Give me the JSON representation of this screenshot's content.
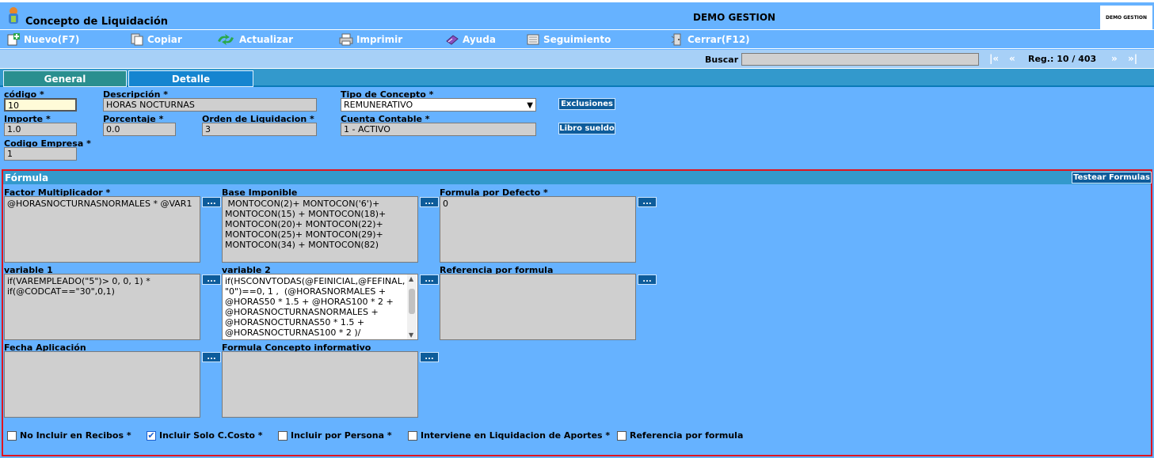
{
  "header": {
    "title": "Concepto de Liquidación",
    "company": "DEMO GESTION",
    "company_logo_text": "DEMO GESTION"
  },
  "toolbar": {
    "items": [
      {
        "label": "Nuevo(F7)",
        "icon": "new-icon"
      },
      {
        "label": "Copiar",
        "icon": "copy-icon"
      },
      {
        "label": "Actualizar",
        "icon": "refresh-icon"
      },
      {
        "label": "Imprimir",
        "icon": "print-icon"
      },
      {
        "label": "Ayuda",
        "icon": "help-icon"
      },
      {
        "label": "Seguimiento",
        "icon": "tracking-icon"
      },
      {
        "label": "Cerrar(F12)",
        "icon": "close-icon"
      }
    ]
  },
  "search": {
    "label": "Buscar",
    "value": "",
    "first": "|«",
    "prev": "«",
    "next": "»",
    "last": "»|",
    "record": "Reg.: 10 / 403"
  },
  "tabs": [
    {
      "label": "General",
      "active": true
    },
    {
      "label": "Detalle",
      "active": false
    }
  ],
  "form": {
    "codigo_label": "código *",
    "codigo_value": "10",
    "descripcion_label": "Descripción *",
    "descripcion_value": "HORAS NOCTURNAS",
    "tipo_label": "Tipo de Concepto *",
    "tipo_value": "REMUNERATIVO",
    "exclusiones_button": "Exclusiones",
    "importe_label": "Importe *",
    "importe_value": "1.0",
    "porcentaje_label": "Porcentaje *",
    "porcentaje_value": "0.0",
    "orden_label": "Orden de Liquidacion *",
    "orden_value": "3",
    "cuenta_label": "Cuenta Contable *",
    "cuenta_value": "1 - ACTIVO",
    "libro_button": "Libro sueldo",
    "empresa_label": "Codigo Empresa *",
    "empresa_value": "1"
  },
  "formula": {
    "title": "Fórmula",
    "test_button": "Testear Formulas",
    "dots": "...",
    "factor_label": "Factor Multiplicador *",
    "factor_value": "@HORASNOCTURNASNORMALES * @VAR1",
    "base_label": "Base Imponible",
    "base_value": " MONTOCON(2)+ MONTOCON('6')+ MONTOCON(15) + MONTOCON(18)+ MONTOCON(20)+ MONTOCON(22)+ MONTOCON(25)+ MONTOCON(29)+ MONTOCON(34) + MONTOCON(82)",
    "defecto_label": "Formula por Defecto *",
    "defecto_value": "0",
    "var1_label": "variable 1",
    "var1_value": "if(VAREMPLEADO(\"5\")> 0, 0, 1) * if(@CODCAT==\"30\",0,1)",
    "var2_label": "variable 2",
    "var2_value": "if(HSCONVTODAS(@FEINICIAL,@FEFINAL, \"0\")==0, 1 ,  (@HORASNORMALES + @HORAS50 * 1.5 + @HORAS100 * 2 + @HORASNOCTURNASNORMALES + @HORASNOCTURNAS50 * 1.5 + @HORASNOCTURNAS100 * 2 )/",
    "ref_label": "Referencia por formula",
    "ref_value": "",
    "fecha_label": "Fecha Aplicación",
    "fecha_value": "",
    "informativo_label": "Formula Concepto informativo",
    "informativo_value": ""
  },
  "checkboxes": [
    {
      "label": "No Incluir en Recibos *",
      "checked": false
    },
    {
      "label": "Incluir Solo C.Costo *",
      "checked": true
    },
    {
      "label": "Incluir por Persona *",
      "checked": false
    },
    {
      "label": "Interviene en Liquidacion de Aportes *",
      "checked": false
    },
    {
      "label": "Referencia por formula",
      "checked": false
    }
  ],
  "colors": {
    "background": "#66b2ff",
    "tab_active": "#2a8f8f",
    "tab_inactive": "#1585d0",
    "button": "#0d5c9b",
    "highlight_border": "#e0141e"
  }
}
